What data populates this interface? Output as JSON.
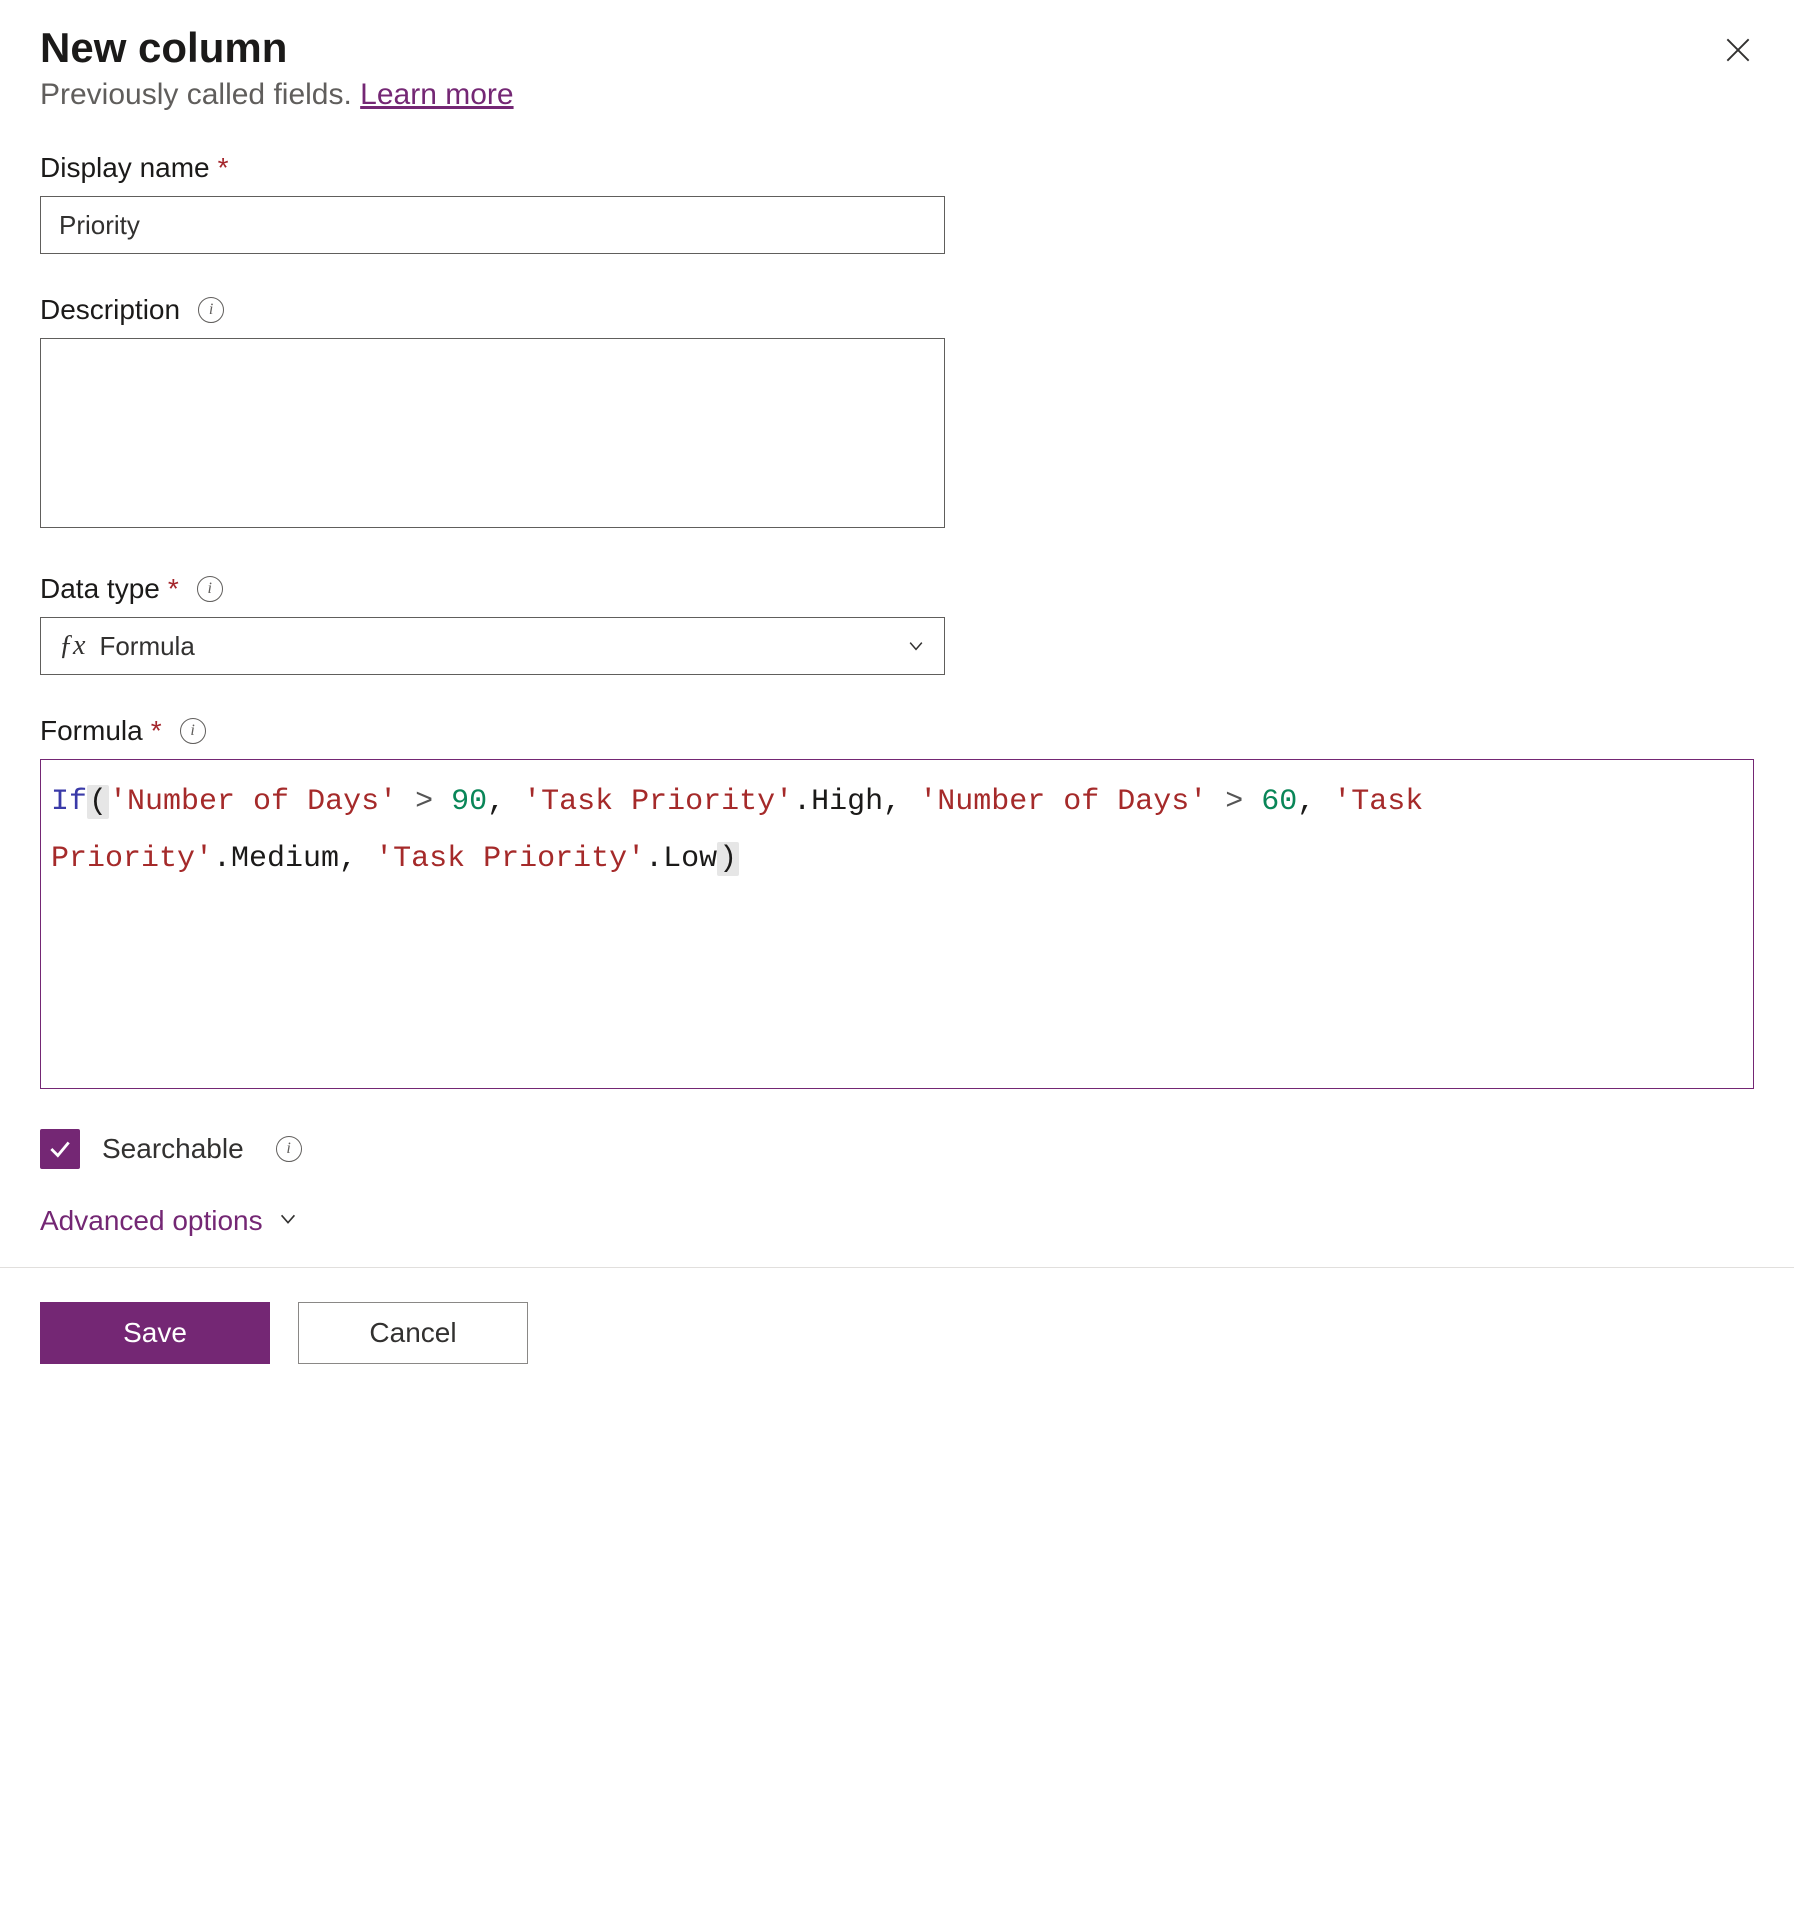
{
  "header": {
    "title": "New column",
    "subtitle_prefix": "Previously called fields. ",
    "learn_more": "Learn more"
  },
  "fields": {
    "display_name": {
      "label": "Display name",
      "value": "Priority"
    },
    "description": {
      "label": "Description",
      "value": ""
    },
    "data_type": {
      "label": "Data type",
      "value": "Formula"
    },
    "formula": {
      "label": "Formula",
      "tokens": {
        "t0": "If",
        "t1": "(",
        "t2": "'Number of Days'",
        "t3": " > ",
        "t4": "90",
        "t5": ", ",
        "t6": "'Task Priority'",
        "t7": ".High, ",
        "t8": "'Number of Days'",
        "t9": " > ",
        "t10": "60",
        "t11": ", ",
        "t12": "'Task Priority'",
        "t13": ".Medium, ",
        "t14": "'Task Priority'",
        "t15": ".Low",
        "t16": ")"
      }
    }
  },
  "searchable": {
    "label": "Searchable",
    "checked": true
  },
  "advanced_options": "Advanced options",
  "buttons": {
    "save": "Save",
    "cancel": "Cancel"
  }
}
